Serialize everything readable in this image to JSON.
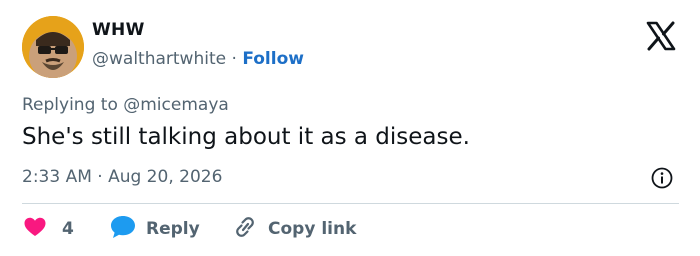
{
  "author": {
    "name": "WHW",
    "handle": "@walthartwhite",
    "separator": "·",
    "follow_label": "Follow"
  },
  "reply_context": {
    "prefix": "Replying to",
    "mention": "@micemaya"
  },
  "tweet": {
    "text": "She's still talking about it as a disease.",
    "timestamp": "2:33 AM · Aug 20, 2026"
  },
  "actions": {
    "like_count": "4",
    "reply_label": "Reply",
    "copy_link_label": "Copy link"
  },
  "icons": {
    "logo": "x-logo-icon",
    "info": "info-icon",
    "like": "heart-icon",
    "reply": "speech-bubble-icon",
    "copy": "link-icon"
  },
  "colors": {
    "heart": "#f91880",
    "reply_bubble": "#1d9bf0",
    "follow": "#1d6fc7",
    "muted": "#536471"
  }
}
